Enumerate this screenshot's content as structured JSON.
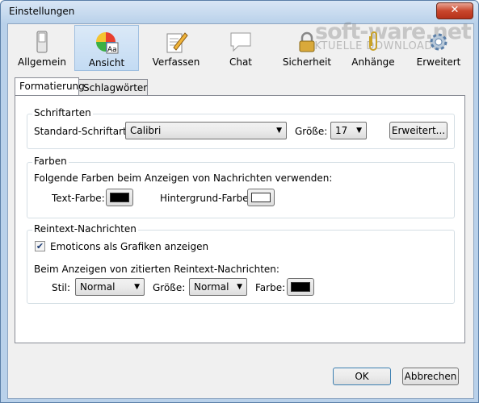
{
  "window": {
    "title": "Einstellungen",
    "close_glyph": "✕"
  },
  "toolbar": {
    "items": [
      {
        "label": "Allgemein",
        "icon": "switch-icon"
      },
      {
        "label": "Ansicht",
        "icon": "color-wheel-icon",
        "selected": true
      },
      {
        "label": "Verfassen",
        "icon": "pencil-paper-icon"
      },
      {
        "label": "Chat",
        "icon": "speech-bubble-icon"
      },
      {
        "label": "Sicherheit",
        "icon": "lock-icon"
      },
      {
        "label": "Anhänge",
        "icon": "paperclip-icon"
      },
      {
        "label": "Erweitert",
        "icon": "gear-icon"
      }
    ]
  },
  "watermark": {
    "line1": "soft-ware.net",
    "line2": "AKTUELLE DOWNLOADS"
  },
  "tabs": [
    {
      "label": "Formatierung",
      "selected": true
    },
    {
      "label": "Schlagwörter",
      "selected": false
    }
  ],
  "schriftarten": {
    "title": "Schriftarten",
    "font_label": "Standard-Schriftart:",
    "font_value": "Calibri",
    "size_label": "Größe:",
    "size_value": "17",
    "advanced_button": "Erweitert..."
  },
  "farben": {
    "title": "Farben",
    "description": "Folgende Farben beim Anzeigen von Nachrichten verwenden:",
    "text_color_label": "Text-Farbe:",
    "text_color": "#000000",
    "bg_color_label": "Hintergrund-Farbe:",
    "bg_color": "#ffffff"
  },
  "reintext": {
    "title": "Reintext-Nachrichten",
    "emoticons_label": "Emoticons als Grafiken anzeigen",
    "emoticons_checked": true,
    "quoted_label": "Beim Anzeigen von zitierten Reintext-Nachrichten:",
    "style_label": "Stil:",
    "style_value": "Normal",
    "size_label": "Größe:",
    "size_value": "Normal",
    "color_label": "Farbe:",
    "color": "#000000"
  },
  "buttons": {
    "ok": "OK",
    "cancel": "Abbrechen"
  },
  "glyphs": {
    "dropdown": "▼",
    "check": "✔"
  }
}
